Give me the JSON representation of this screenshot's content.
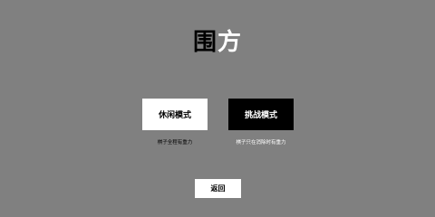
{
  "title": {
    "part1": "围",
    "part2": "方"
  },
  "modes": {
    "casual": {
      "label": "休闲模式",
      "description": "棋子全程有重力"
    },
    "challenge": {
      "label": "挑战模式",
      "description": "棋子只在消除时有重力"
    }
  },
  "back_label": "返回",
  "colors": {
    "background": "#808080",
    "casual_button": "#ffffff",
    "challenge_button": "#000000",
    "back_button": "#ffffff"
  }
}
